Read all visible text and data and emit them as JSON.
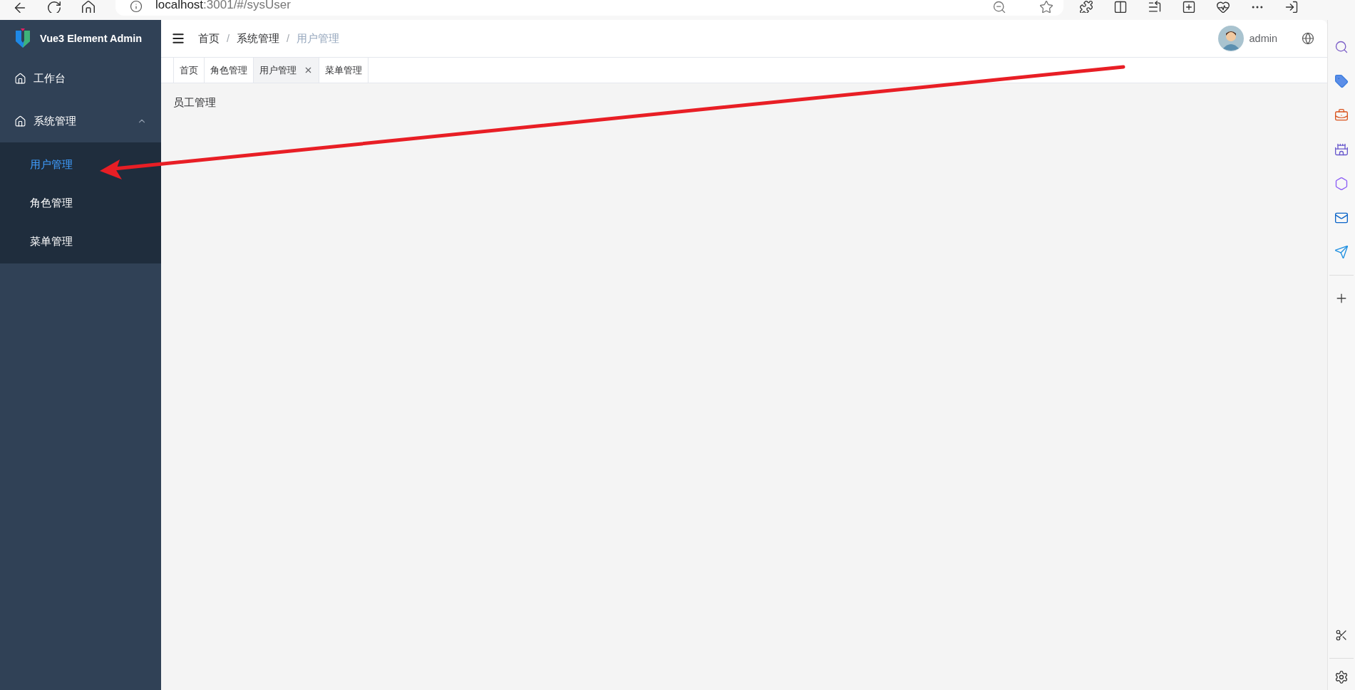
{
  "browser": {
    "url_host": "localhost",
    "url_path": ":3001/#/sysUser"
  },
  "app": {
    "logo_text": "Vue3 Element Admin"
  },
  "sidebar": {
    "items": [
      {
        "label": "工作台",
        "selected": false
      },
      {
        "label": "系统管理",
        "selected": false,
        "expanded": true,
        "children": [
          {
            "label": "用户管理",
            "selected": true
          },
          {
            "label": "角色管理",
            "selected": false
          },
          {
            "label": "菜单管理",
            "selected": false
          }
        ]
      }
    ]
  },
  "breadcrumb": [
    {
      "label": "首页",
      "separator": "/"
    },
    {
      "label": "系统管理",
      "separator": "/"
    },
    {
      "label": "用户管理"
    }
  ],
  "user": {
    "name": "admin"
  },
  "tabs": [
    {
      "label": "首页",
      "selected": false
    },
    {
      "label": "角色管理",
      "selected": false
    },
    {
      "label": "用户管理",
      "selected": true
    },
    {
      "label": "菜单管理",
      "selected": false
    }
  ],
  "content": {
    "text": "员工管理"
  }
}
